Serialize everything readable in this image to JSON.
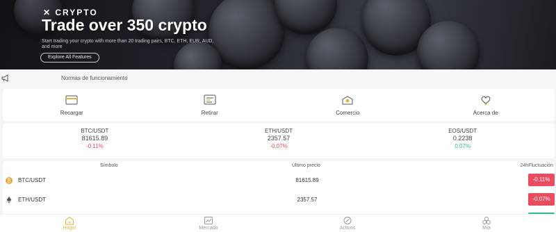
{
  "banner": {
    "logo": "✕ CRYPTO",
    "title": "Trade over 350 crypto",
    "subtitle": "Start trading your crypto with more than 20 trading pairs, BTC, ETH, EUR, AUD, and more",
    "button_label": "Explore All Features"
  },
  "notice": {
    "text": "Normas de funcionamiento"
  },
  "menu": {
    "items": [
      {
        "label": "Recargar",
        "icon": "card-icon"
      },
      {
        "label": "Retirar",
        "icon": "withdraw-icon"
      },
      {
        "label": "Comercio",
        "icon": "trade-icon"
      },
      {
        "label": "Acerca de",
        "icon": "about-icon"
      }
    ]
  },
  "tickers": [
    {
      "pair": "BTC/USDT",
      "price": "81615.89",
      "change": "-0.11%",
      "direction": "down"
    },
    {
      "pair": "ETH/USDT",
      "price": "2357.57",
      "change": "-0.07%",
      "direction": "down"
    },
    {
      "pair": "EOS/USDT",
      "price": "0.2238",
      "change": "0.07%",
      "direction": "up"
    }
  ],
  "market": {
    "headers": {
      "symbol": "Símbolo",
      "price": "Último precio",
      "change": "24hFluctuación"
    },
    "rows": [
      {
        "symbol": "BTC/USDT",
        "price": "81615.89",
        "change": "-0.11%",
        "direction": "down",
        "icon": "bitcoin-icon"
      },
      {
        "symbol": "ETH/USDT",
        "price": "2357.57",
        "change": "-0.07%",
        "direction": "down",
        "icon": "ethereum-icon"
      },
      {
        "symbol": "",
        "price": "",
        "change": "",
        "direction": "up",
        "icon": ""
      }
    ]
  },
  "bottom_nav": {
    "items": [
      {
        "label": "Hogar",
        "icon": "home-icon",
        "active": true
      },
      {
        "label": "Mercado",
        "icon": "market-icon",
        "active": false
      },
      {
        "label": "Activos",
        "icon": "assets-icon",
        "active": false
      },
      {
        "label": "Mía",
        "icon": "profile-icon",
        "active": false
      }
    ]
  },
  "colors": {
    "accent": "#e0b53a",
    "negative": "#ea4b5f",
    "positive": "#2ebd85"
  }
}
